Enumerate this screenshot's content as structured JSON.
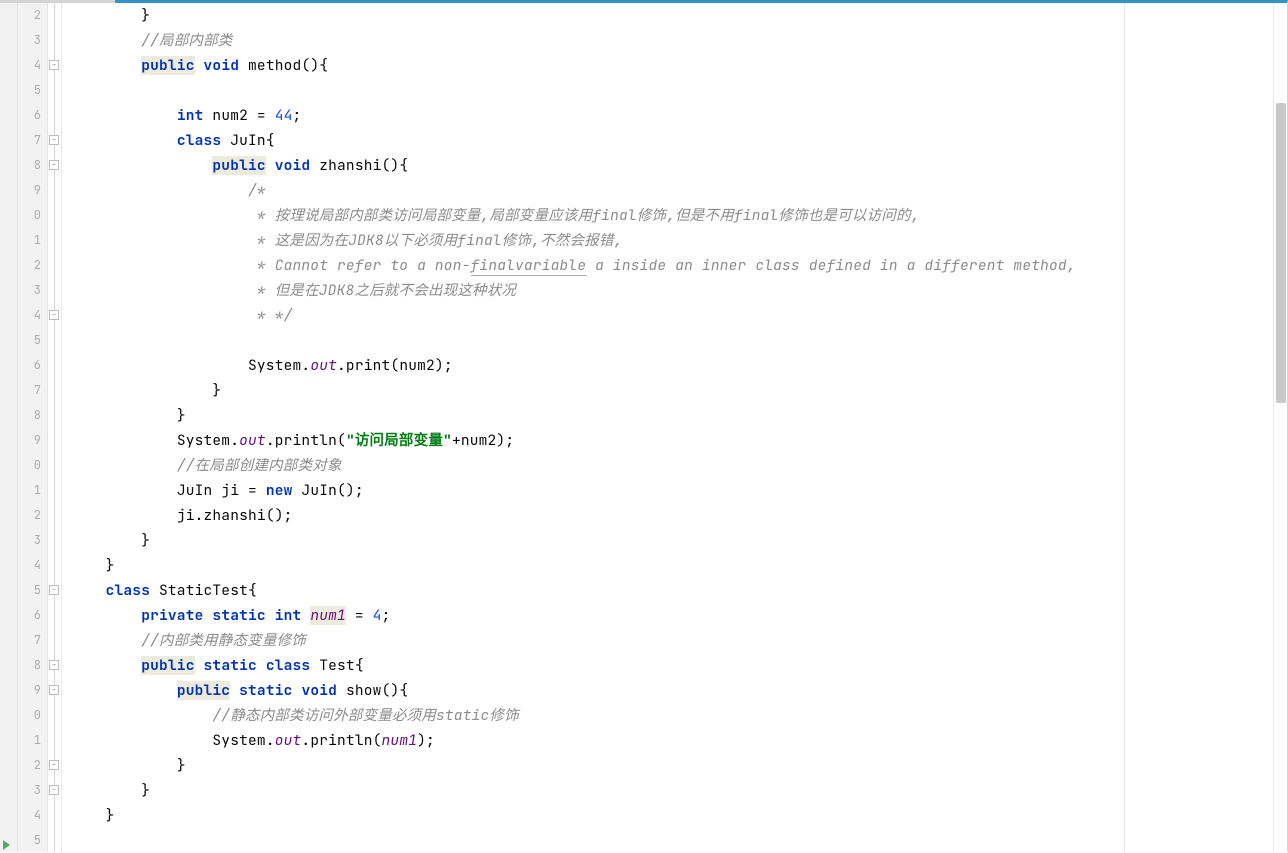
{
  "line_numbers": [
    "2",
    "3",
    "4",
    "5",
    "6",
    "7",
    "8",
    "9",
    "0",
    "1",
    "2",
    "3",
    "4",
    "5",
    "6",
    "7",
    "8",
    "9",
    "0",
    "1",
    "2",
    "3",
    "4",
    "5",
    "6",
    "7",
    "8",
    "9",
    "0",
    "1",
    "2",
    "3",
    "4",
    "5"
  ],
  "code": {
    "l0": {
      "indent": "        ",
      "t1": "}"
    },
    "l1": {
      "indent": "        ",
      "c": "//局部内部类"
    },
    "l2": {
      "indent": "        ",
      "k1": "public",
      "k2": "void",
      "t": " method(){"
    },
    "l3": {
      "indent": ""
    },
    "l4": {
      "indent": "            ",
      "k1": "int",
      "t1": " num2 = ",
      "n": "44",
      "t2": ";"
    },
    "l5": {
      "indent": "            ",
      "k1": "class",
      "t": " JuIn{"
    },
    "l6": {
      "indent": "                ",
      "k1": "public",
      "k2": "void",
      "t": " zhanshi(){"
    },
    "l7": {
      "indent": "                    ",
      "c": "/*"
    },
    "l8": {
      "indent": "                     ",
      "c": "* 按理说局部内部类访问局部变量,局部变量应该用final修饰,但是不用final修饰也是可以访问的,"
    },
    "l9": {
      "indent": "                     ",
      "c": "* 这是因为在JDK8以下必须用final修饰,不然会报错,"
    },
    "l10": {
      "indent": "                     ",
      "c1": "* Cannot refer to a non-",
      "cu": "finalvariable",
      "c2": " a inside an inner class defined in a different method,"
    },
    "l11": {
      "indent": "                     ",
      "c": "* 但是在JDK8之后就不会出现这种状况"
    },
    "l12": {
      "indent": "                     ",
      "c": "* */"
    },
    "l13": {
      "indent": ""
    },
    "l14": {
      "indent": "                    ",
      "t1": "System.",
      "f": "out",
      "t2": ".print(num2);"
    },
    "l15": {
      "indent": "                ",
      "t": "}"
    },
    "l16": {
      "indent": "            ",
      "t": "}"
    },
    "l17": {
      "indent": "            ",
      "t1": "System.",
      "f": "out",
      "t2": ".println(",
      "s": "\"访问局部变量\"",
      "t3": "+num2);"
    },
    "l18": {
      "indent": "            ",
      "c": "//在局部创建内部类对象"
    },
    "l19": {
      "indent": "            ",
      "t1": "JuIn ji = ",
      "k": "new",
      "t2": " JuIn();"
    },
    "l20": {
      "indent": "            ",
      "t": "ji.zhanshi();"
    },
    "l21": {
      "indent": "        ",
      "t": "}"
    },
    "l22": {
      "indent": "    ",
      "t": "}"
    },
    "l23": {
      "indent": "    ",
      "k1": "class",
      "t": " StaticTest{"
    },
    "l24": {
      "indent": "        ",
      "k1": "private",
      "k2": "static",
      "k3": "int",
      "f": "num1",
      "t1": " = ",
      "n": "4",
      "t2": ";"
    },
    "l25": {
      "indent": "        ",
      "c": "//内部类用静态变量修饰"
    },
    "l26": {
      "indent": "        ",
      "k1": "public",
      "k2": "static",
      "k3": "class",
      "t": " Test{"
    },
    "l27": {
      "indent": "            ",
      "k1": "public",
      "k2": "static",
      "k3": "void",
      "t": " show(){"
    },
    "l28": {
      "indent": "                ",
      "c": "//静态内部类访问外部变量必须用static修饰"
    },
    "l29": {
      "indent": "                ",
      "t1": "System.",
      "f": "out",
      "t2": ".println(",
      "f2": "num1",
      "t3": ");"
    },
    "l30": {
      "indent": "            ",
      "t": "}"
    },
    "l31": {
      "indent": "        ",
      "t": "}"
    },
    "l32": {
      "indent": "    ",
      "t": "}"
    }
  }
}
